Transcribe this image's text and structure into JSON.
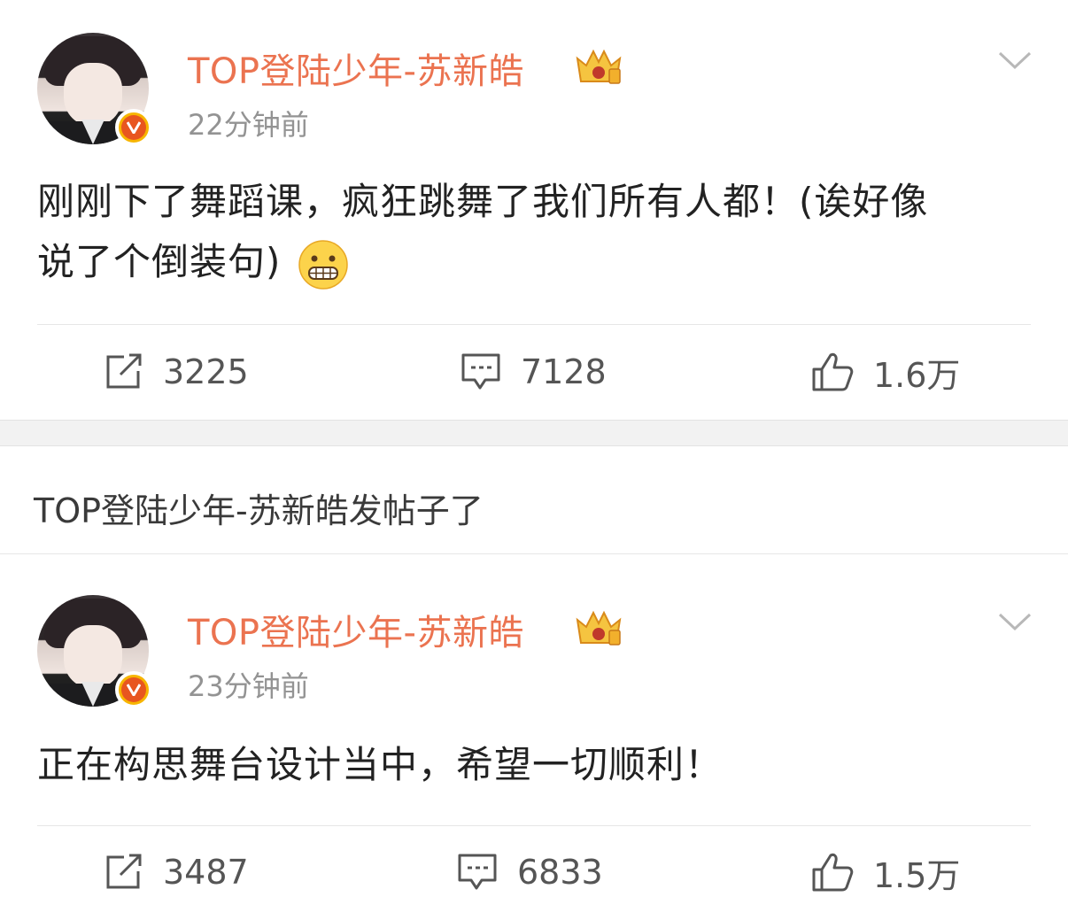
{
  "posts": [
    {
      "username": "TOP登陆少年-苏新皓",
      "time": "22分钟前",
      "content_line1": "刚刚下了舞蹈课，疯狂跳舞了我们所有人都！(诶好像",
      "content_line2": "说了个倒装句)",
      "emoji": "grimacing-face-emoji",
      "repost_count": "3225",
      "comment_count": "7128",
      "like_count": "1.6万"
    },
    {
      "username": "TOP登陆少年-苏新皓",
      "time": "23分钟前",
      "content_line1": "正在构思舞台设计当中，希望一切顺利！",
      "repost_count": "3487",
      "comment_count": "6833",
      "like_count": "1.5万"
    }
  ],
  "notice": "TOP登陆少年-苏新皓发帖子了",
  "colors": {
    "username": "#eb7350",
    "time": "#939393",
    "badge_outer": "#f7b500",
    "badge_inner": "#e8561f",
    "divider": "#e6e6e6",
    "band": "#f2f2f2"
  },
  "icons": {
    "repost": "repost-icon",
    "comment": "comment-icon",
    "like": "thumbs-up-icon",
    "menu": "chevron-down-icon",
    "verified": "verified-v-badge-icon",
    "member": "crown-member-icon"
  }
}
